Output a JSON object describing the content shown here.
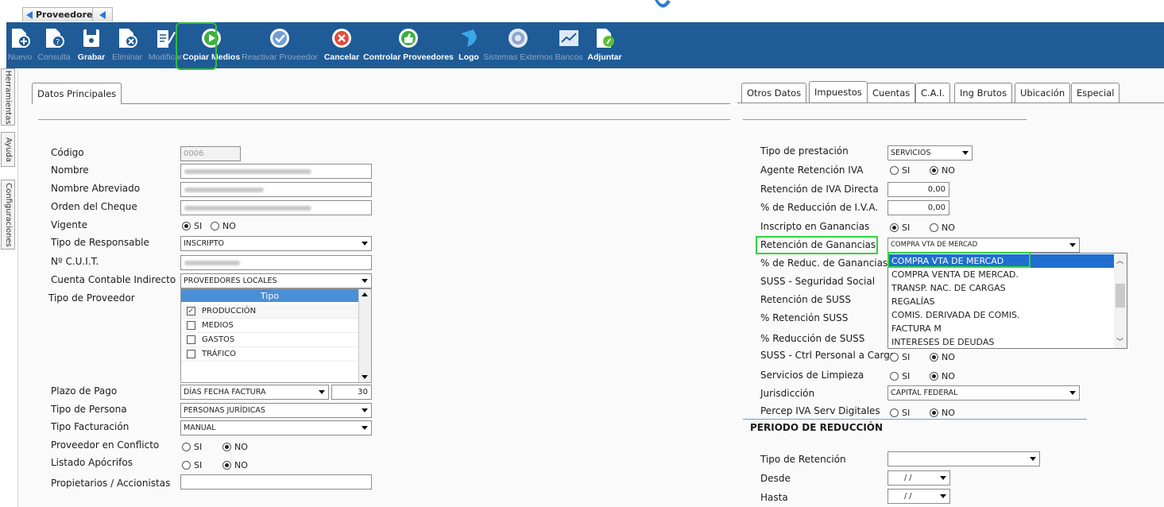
{
  "doc_tab": {
    "label": "Proveedores"
  },
  "toolbar": {
    "buttons": [
      {
        "label": "Nuevo",
        "icon": "new-doc-icon",
        "enabled": false
      },
      {
        "label": "Consulta",
        "icon": "query-doc-icon",
        "enabled": false
      },
      {
        "label": "Grabar",
        "icon": "save-icon",
        "enabled": true
      },
      {
        "label": "Eliminar",
        "icon": "delete-doc-icon",
        "enabled": false
      },
      {
        "label": "Modificar",
        "icon": "edit-pencil-icon",
        "enabled": false
      },
      {
        "label": "Copiar Medios",
        "icon": "play-circle-icon",
        "enabled": true
      },
      {
        "label": "Reactivar Proveedor",
        "icon": "check-circle-icon",
        "enabled": false
      },
      {
        "label": "Cancelar",
        "icon": "cancel-circle-icon",
        "enabled": true
      },
      {
        "label": "Controlar Proveedores",
        "icon": "thumbs-up-icon",
        "enabled": true
      },
      {
        "label": "Logo",
        "icon": "logo-icon",
        "enabled": true
      },
      {
        "label": "Sistemas Externos",
        "icon": "external-systems-icon",
        "enabled": false
      },
      {
        "label": "Bancos",
        "icon": "chart-icon",
        "enabled": false
      },
      {
        "label": "Adjuntar",
        "icon": "attach-doc-icon",
        "enabled": true
      }
    ]
  },
  "side_tabs": [
    "Herramientas",
    "Ayuda",
    "Configuraciones"
  ],
  "left": {
    "tab": "Datos Principales",
    "codigo_label": "Código",
    "codigo_value": "0006",
    "nombre_label": "Nombre",
    "nombre_abreviado_label": "Nombre Abreviado",
    "orden_cheque_label": "Orden del Cheque",
    "vigente_label": "Vigente",
    "tipo_responsable_label": "Tipo de Responsable",
    "tipo_responsable_value": "INSCRIPTO",
    "cuit_label": "Nº C.U.I.T.",
    "cuenta_label": "Cuenta Contable Indirecto",
    "cuenta_value": "PROVEEDORES LOCALES",
    "tipo_proveedor_label": "Tipo de Proveedor",
    "tipo_header": "Tipo",
    "tipos": [
      {
        "label": "PRODUCCIÓN",
        "checked": true
      },
      {
        "label": "MEDIOS",
        "checked": false
      },
      {
        "label": "GASTOS",
        "checked": false
      },
      {
        "label": "TRÁFICO",
        "checked": false
      }
    ],
    "plazo_label": "Plazo de Pago",
    "plazo_value": "DÍAS FECHA FACTURA",
    "plazo_days": "30",
    "tipo_persona_label": "Tipo de Persona",
    "tipo_persona_value": "PERSONAS JURÍDICAS",
    "tipo_facturacion_label": "Tipo Facturación",
    "tipo_facturacion_value": "MANUAL",
    "conflicto_label": "Proveedor en Conflicto",
    "apocrifos_label": "Listado Apócrifos",
    "propietarios_label": "Propietarios / Accionistas",
    "si": "SI",
    "no": "NO"
  },
  "right": {
    "tabs": [
      "Otros Datos",
      "Impuestos",
      "Cuentas",
      "C.A.I.",
      "Ing Brutos",
      "Ubicación",
      "Especial"
    ],
    "active_tab": "Impuestos",
    "tipo_prestacion_label": "Tipo de prestación",
    "tipo_prestacion_value": "SERVICIOS",
    "agente_iva_label": "Agente Retención IVA",
    "ret_iva_directa_label": "Retención de IVA Directa",
    "ret_iva_directa_value": "0,00",
    "red_iva_label": "% de Reducción de I.V.A.",
    "red_iva_value": "0,00",
    "inscripto_ganancias_label": "Inscripto en Ganancias",
    "ret_ganancias_label": "Retención de Ganancias",
    "ret_ganancias_value": "COMPRA VTA DE MERCAD",
    "red_ganancias_label": "% de Reduc. de Ganancias",
    "suss_label": "SUSS - Seguridad Social",
    "ret_suss_label": "Retención de SUSS",
    "pct_ret_suss_label": "% Retención SUSS",
    "pct_red_suss_label": "% Reducción de SUSS",
    "suss_ctrl_label": "SUSS - Ctrl Personal a Cargo",
    "limpieza_label": "Servicios de Limpieza",
    "jurisdiccion_label": "Jurisdicción",
    "jurisdiccion_value": "CAPITAL FEDERAL",
    "percep_label": "Percep IVA Serv Digitales",
    "periodo_title": "PERIODO DE REDUCCIÓN",
    "tipo_retencion_label": "Tipo de Retención",
    "desde_label": "Desde",
    "desde_value": "/ /",
    "hasta_label": "Hasta",
    "hasta_value": "/ /",
    "dropdown_options": [
      "COMPRA VTA DE MERCAD",
      "COMPRA VENTA DE MERCAD.",
      "TRANSP. NAC. DE CARGAS",
      "REGALÍAS",
      "COMIS. DERIVADA DE COMIS.",
      "FACTURA M",
      "INTERESES DE DEUDAS"
    ],
    "si": "SI",
    "no": "NO"
  }
}
